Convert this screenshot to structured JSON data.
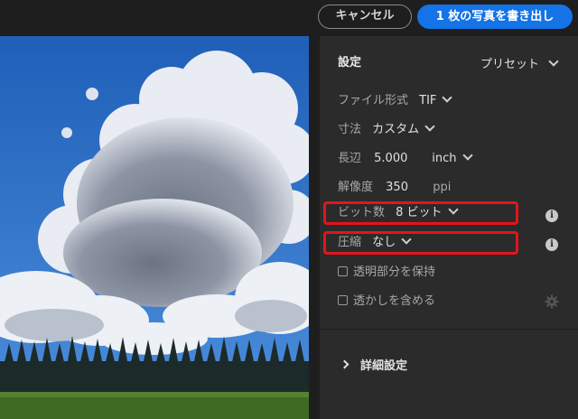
{
  "toolbar": {
    "cancel_label": "キャンセル",
    "export_label": "1 枚の写真を書き出し",
    "export_color": "#1473e6"
  },
  "panel": {
    "section_title": "設定",
    "presets_label": "プリセット",
    "file_format": {
      "label": "ファイル形式",
      "value": "TIF"
    },
    "dimensions": {
      "label": "寸法",
      "value": "カスタム"
    },
    "long_edge": {
      "label": "長辺",
      "value": "5.000",
      "unit": "inch"
    },
    "resolution": {
      "label": "解像度",
      "value": "350",
      "unit": "ppi"
    },
    "bit_depth": {
      "label": "ビット数",
      "value": "8 ビット"
    },
    "compression": {
      "label": "圧縮",
      "value": "なし"
    },
    "preserve_transparency": {
      "label": "透明部分を保持",
      "checked": false
    },
    "watermark": {
      "label": "透かしを含める",
      "checked": false
    },
    "advanced_label": "詳細設定",
    "highlight_color": "#e4141b"
  },
  "icons": {
    "info": "info-icon",
    "gear": "gear-icon",
    "chevron": "chevron-down-icon"
  }
}
